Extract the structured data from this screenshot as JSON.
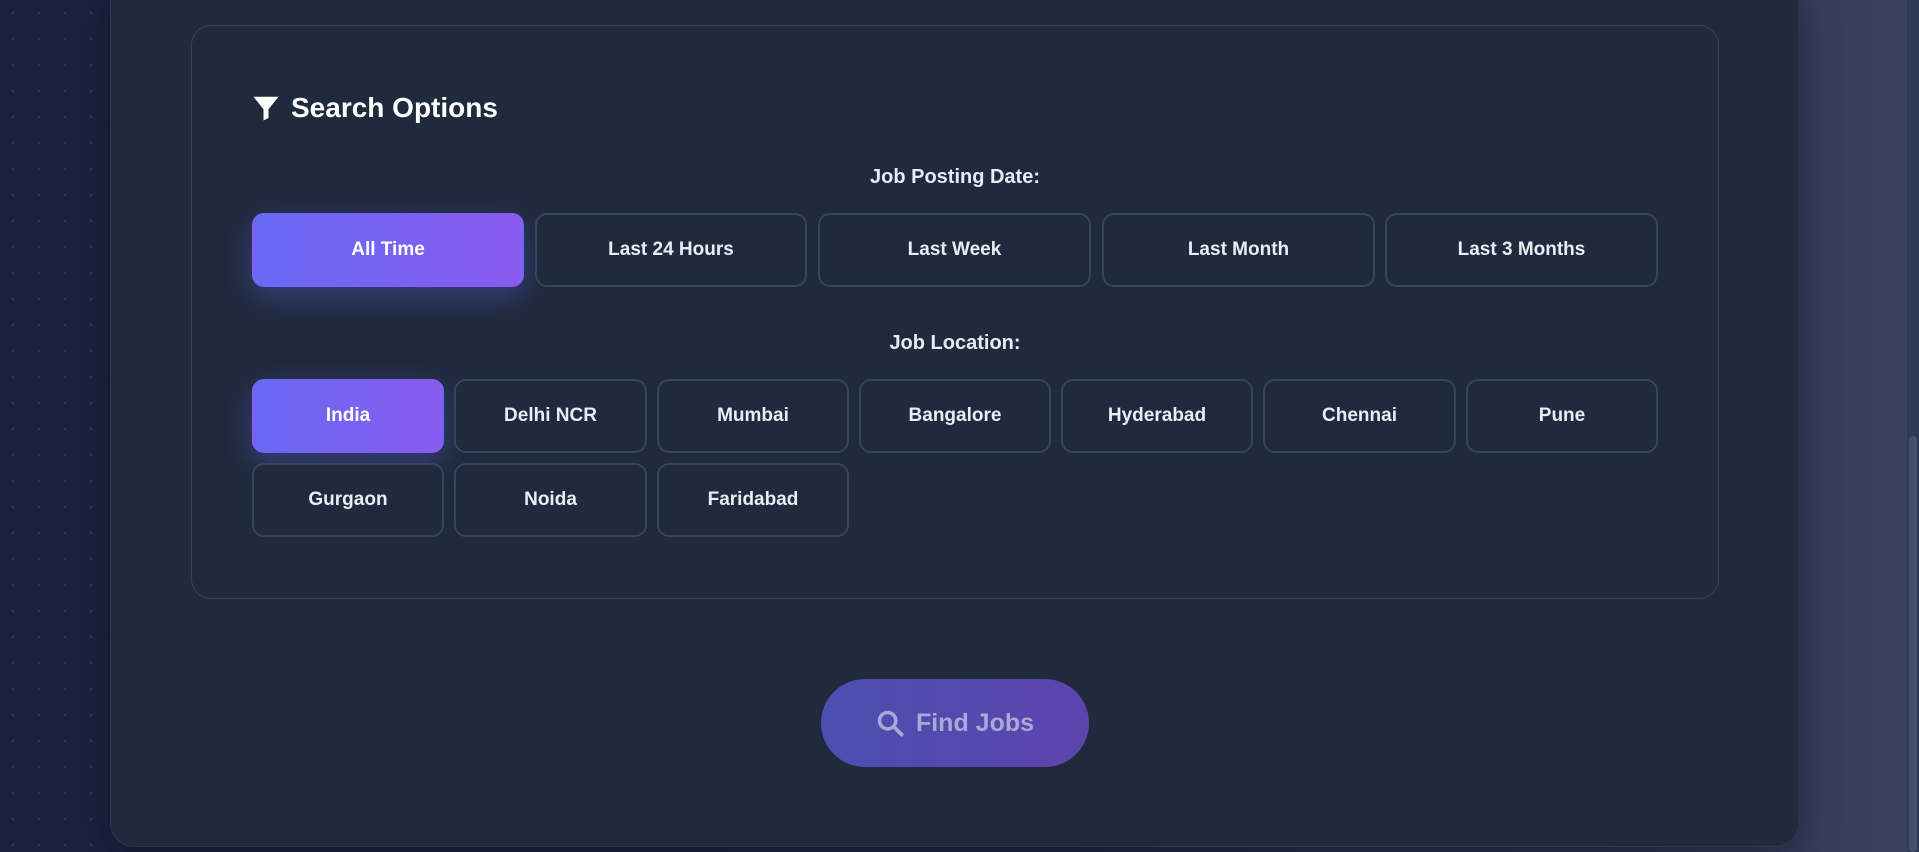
{
  "search_options": {
    "title": "Search Options",
    "title_icon": "filter-icon",
    "posting_date": {
      "label": "Job Posting Date:",
      "selected": "All Time",
      "options": [
        "All Time",
        "Last 24 Hours",
        "Last Week",
        "Last Month",
        "Last 3 Months"
      ]
    },
    "location": {
      "label": "Job Location:",
      "selected": "India",
      "options": [
        "India",
        "Delhi NCR",
        "Mumbai",
        "Bangalore",
        "Hyderabad",
        "Chennai",
        "Pune",
        "Gurgaon",
        "Noida",
        "Faridabad"
      ]
    }
  },
  "actions": {
    "find_jobs_label": "Find Jobs",
    "find_jobs_icon": "search-icon"
  },
  "colors": {
    "accent_start": "#6868f4",
    "accent_end": "#8a5cf0",
    "card_background": "#1f2a3d"
  }
}
